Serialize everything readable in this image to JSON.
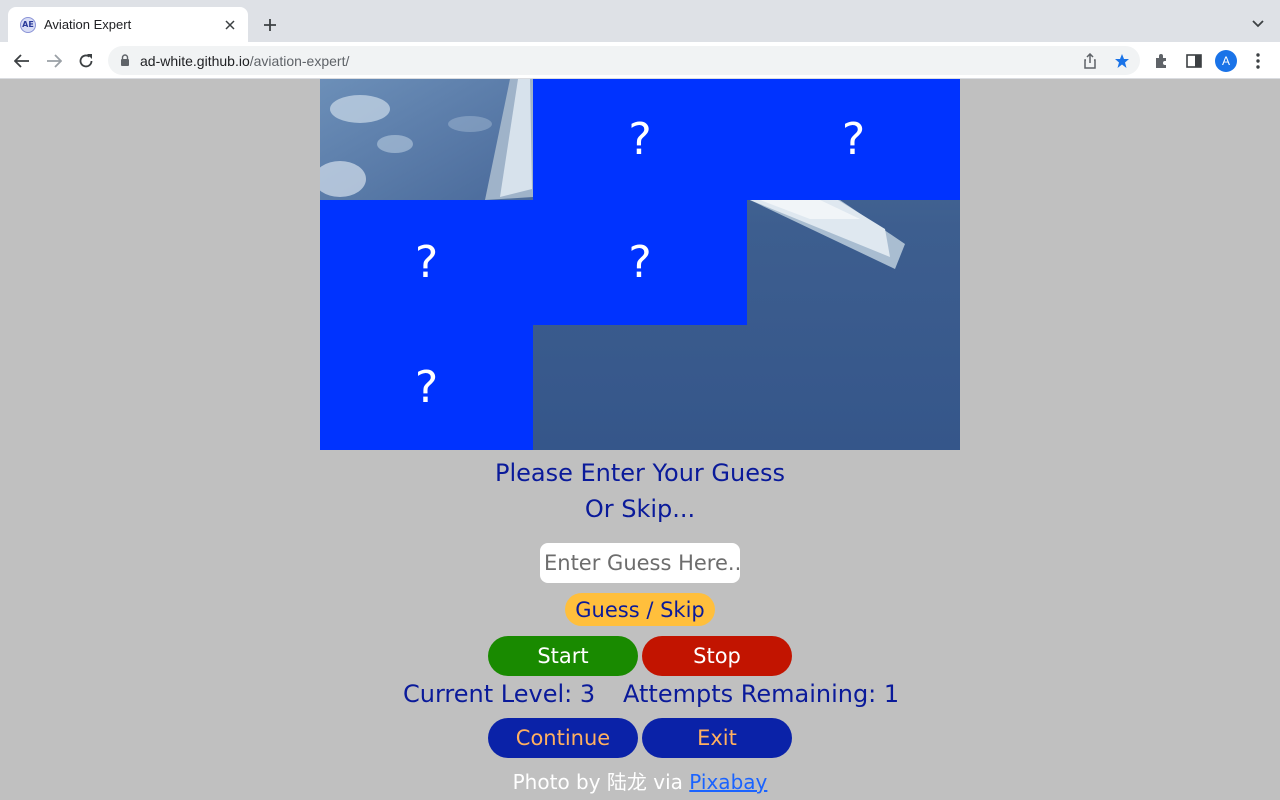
{
  "browser": {
    "tab_title": "Aviation Expert",
    "favicon_text": "AE",
    "url_host": "ad-white.github.io",
    "url_path": "/aviation-expert/",
    "profile_initial": "A"
  },
  "game": {
    "hidden_tile_label": "?",
    "tiles": [
      {
        "row": 0,
        "col": 0,
        "revealed": true
      },
      {
        "row": 0,
        "col": 1,
        "revealed": false
      },
      {
        "row": 0,
        "col": 2,
        "revealed": false
      },
      {
        "row": 1,
        "col": 0,
        "revealed": false
      },
      {
        "row": 1,
        "col": 1,
        "revealed": false
      },
      {
        "row": 1,
        "col": 2,
        "revealed": true
      },
      {
        "row": 2,
        "col": 0,
        "revealed": false
      },
      {
        "row": 2,
        "col": 1,
        "revealed": true
      },
      {
        "row": 2,
        "col": 2,
        "revealed": true
      }
    ],
    "prompt_line1": "Please Enter Your Guess",
    "prompt_line2": "Or Skip...",
    "guess_placeholder": "Enter Guess Here...",
    "guess_value": "",
    "guess_button": "Guess / Skip",
    "start_button": "Start",
    "stop_button": "Stop",
    "current_level": "Current Level: 3",
    "attempts_remaining": "Attempts Remaining: 1",
    "continue_button": "Continue",
    "exit_button": "Exit",
    "credit_text": "Photo by 陆龙 via ",
    "credit_link": "Pixabay"
  },
  "colors": {
    "page_bg": "#c0c0c0",
    "hidden_tile": "#0033ff",
    "text_blue": "#0a1a9a",
    "guess_button": "#ffbf3c",
    "start_button": "#198a00",
    "stop_button": "#c21400",
    "nav_button": "#0a22a8",
    "nav_text": "#ffb060"
  }
}
